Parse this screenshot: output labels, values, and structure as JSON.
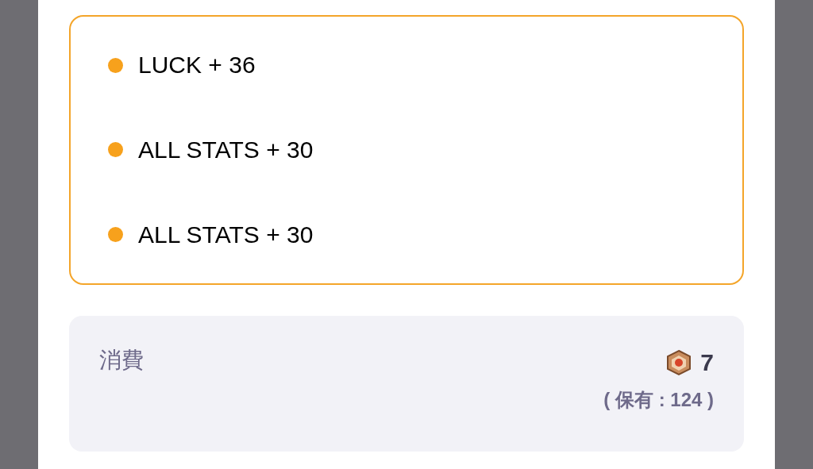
{
  "stats": [
    "LUCK + 36",
    "ALL STATS + 30",
    "ALL STATS + 30"
  ],
  "cost": {
    "label": "消費",
    "amount": "7",
    "owned": "( 保有 : 124 )"
  }
}
